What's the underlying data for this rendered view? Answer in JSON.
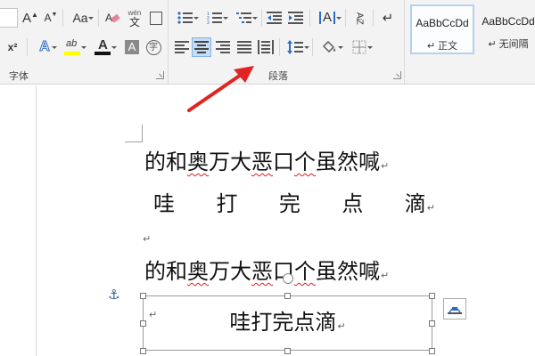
{
  "ribbon": {
    "font_group_label": "字体",
    "paragraph_group_label": "段落",
    "font": {
      "grow_font": "A",
      "shrink_font": "A",
      "change_case": "Aa",
      "phonetic_top": "wén",
      "phonetic_bottom": "文",
      "superscript": "x²",
      "text_effect": "A",
      "highlight": "ab",
      "font_color": "A",
      "char_shading": "A",
      "enclose_char": "字"
    },
    "paragraph": {
      "sort": "A↓Z",
      "chinese_layout": "A",
      "show_marks": "↵"
    },
    "styles": [
      {
        "sample": "AaBbCcDd",
        "name": "↵ 正文"
      },
      {
        "sample": "AaBbCcDd",
        "name": "↵ 无间隔"
      }
    ],
    "colors": {
      "accent": "#2b579a",
      "highlight": "#ffff00",
      "font_color": "#c00000",
      "arrow": "#e02424"
    }
  },
  "document": {
    "para_mark": "↵",
    "line1": "的和奥万大恶口个虽然喊",
    "line2_chars": [
      "哇",
      "打",
      "完",
      "点",
      "滴"
    ],
    "line4": "的和奥万大恶口个虽然喊",
    "textbox_text": "哇打完点滴",
    "anchor_icon": "⚓"
  }
}
